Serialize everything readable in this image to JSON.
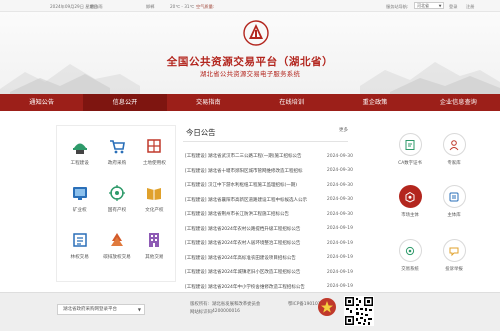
{
  "topbar": {
    "date": "2024年09月29日 星期日",
    "weather": "雷阵雨",
    "city": "邯郸",
    "temp": "20℃ - 31℃",
    "air": "空气质量:",
    "region_label": "服务站导航:",
    "region_value": "河北省",
    "link1": "登录",
    "link2": "注册"
  },
  "header": {
    "title": "全国公共资源交易平台（湖北省）",
    "subtitle": "湖北省公共资源交易电子服务系统"
  },
  "nav": [
    "通知公告",
    "信息公开",
    "交易指南",
    "在线培训",
    "重企政策",
    "企业信息查询"
  ],
  "services": [
    {
      "label": "工程建设",
      "icon": "engineering-icon"
    },
    {
      "label": "政府采购",
      "icon": "cart-icon"
    },
    {
      "label": "土地使用权",
      "icon": "land-icon"
    },
    {
      "label": "矿业权",
      "icon": "mining-icon"
    },
    {
      "label": "国有产权",
      "icon": "property-icon"
    },
    {
      "label": "文化产权",
      "icon": "culture-icon"
    },
    {
      "label": "林权交易",
      "icon": "forest-icon"
    },
    {
      "label": "碳排放权交易",
      "icon": "carbon-icon"
    },
    {
      "label": "其他交易",
      "icon": "other-icon"
    }
  ],
  "news": {
    "title": "今日公告",
    "more": "更多",
    "items": [
      {
        "text": "[工程建设] 湖北省武汉市二三公路工程(一期)施工招标公告",
        "date": "2024-09-30"
      },
      {
        "text": "[工程建设] 湖北省十堰市郧阳区城市管网维修改造工程招标",
        "date": "2024-09-30"
      },
      {
        "text": "[工程建设] 汉江中下游水利枢纽工程施工监理招标(一期)",
        "date": "2024-09-30"
      },
      {
        "text": "[工程建设] 湖北省襄阳市高新区道路建设工程中标候选人公示",
        "date": "2024-09-30"
      },
      {
        "text": "[工程建设] 湖北省荆州市长江防洪工程施工招标公告",
        "date": "2024-09-30"
      },
      {
        "text": "[工程建设] 湖北省2024年农村公路提档升级工程招标公告",
        "date": "2024-09-19"
      },
      {
        "text": "[工程建设] 湖北省2024年农村人居环境整治工程招标公告",
        "date": "2024-09-19"
      },
      {
        "text": "[工程建设] 湖北省2024年高标准农田建设项目招标公告",
        "date": "2024-09-19"
      },
      {
        "text": "[工程建设] 湖北省2024年城镇老旧小区改造工程招标公告",
        "date": "2024-09-19"
      },
      {
        "text": "[工程建设] 湖北省2024年中小学校舍维修改造工程招标公告",
        "date": "2024-09-19"
      }
    ]
  },
  "quick": [
    {
      "label": "CA数字证书",
      "icon": "certificate-icon",
      "style": "outline"
    },
    {
      "label": "专家库",
      "icon": "expert-icon",
      "style": "outline"
    },
    {
      "label": "市场主体",
      "icon": "market-icon",
      "style": "filled"
    },
    {
      "label": "主体库",
      "icon": "subject-icon",
      "style": "outline"
    },
    {
      "label": "交易系统",
      "icon": "trade-system-icon",
      "style": "outline"
    },
    {
      "label": "投诉举报",
      "icon": "complaint-icon",
      "style": "outline"
    }
  ],
  "footer": {
    "select": "湖北省政府采购网登录平台",
    "label1": "版权所有:",
    "value1": "湖北省发展和改革委员会",
    "label2": "网站标识码:",
    "value2": "4200000016",
    "icp": "鄂ICP备19010116号-2"
  },
  "colors": {
    "brand": "#b3261e",
    "nav": "#9c1f19",
    "nav_active": "#7e1510"
  }
}
